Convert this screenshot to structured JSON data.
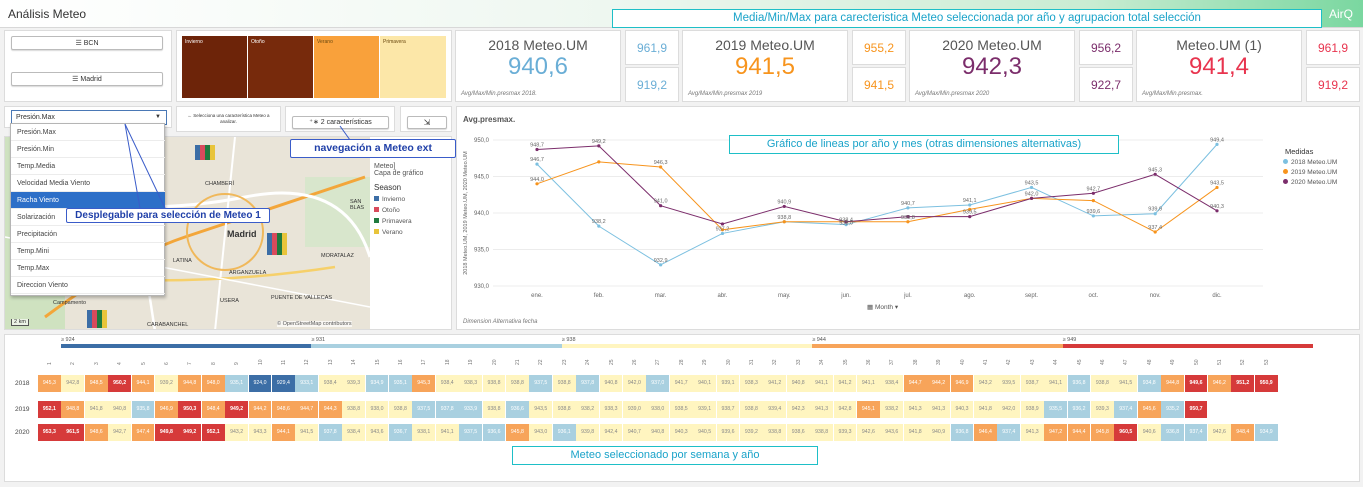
{
  "app": {
    "title": "Análisis Meteo",
    "brand": "AirQ"
  },
  "annotations": {
    "kpis": "Media/Min/Max  para carecteristica Meteo seleccionada por año y agrupacion total selección",
    "line": "Gráfico de lineas por año y mes (otras dimensiones alternativas)",
    "dropdown": "Desplegable para selección de Meteo 1",
    "nav": "navegación a Meteo ext",
    "heatmap": "Meteo seleccionado por semana y año"
  },
  "filters": {
    "bcn": "BCN",
    "madrid": "Madrid"
  },
  "seasons_tree": [
    {
      "label": "Invierno",
      "color": "#6d2409"
    },
    {
      "label": "Otoño",
      "color": "#772a0c"
    },
    {
      "label": "Verano",
      "color": "#f9a13b"
    },
    {
      "label": "Primavera",
      "color": "#fce7a8"
    }
  ],
  "controls": {
    "hint": "← Selecciona una característica Meteo a analizar.",
    "chars_button": "2 características",
    "export_icon": "export-icon"
  },
  "dropdown": {
    "selected": "Presión.Max",
    "items": [
      "Presión.Max",
      "Presión.Min",
      "Temp.Media",
      "Velocidad Media Viento",
      "Racha Viento",
      "Solarización",
      "Precipitación",
      "Temp.Mini",
      "Temp.Max",
      "Direccion Viento"
    ],
    "highlighted": "Racha Viento"
  },
  "map": {
    "labels": [
      "CHAMBERÍ",
      "SAN BLAS",
      "Madrid",
      "LATINA",
      "ARGANZUELA",
      "MORATALAZ",
      "USERA",
      "PUENTE DE VALLECAS",
      "Campamento",
      "CARABANCHEL"
    ],
    "legend_head": "Meteo]",
    "legend_sub": "Capa de gráfico",
    "legend_title": "Season",
    "legend": [
      {
        "label": "Invierno",
        "color": "#3c6ea6"
      },
      {
        "label": "Otoño",
        "color": "#d94a5c"
      },
      {
        "label": "Primavera",
        "color": "#1f7a3f"
      },
      {
        "label": "Verano",
        "color": "#e8c43a"
      }
    ],
    "scale": "2 km",
    "credit": "© OpenStreetMap contributors"
  },
  "kpis": [
    {
      "title": "2018 Meteo.UM",
      "value": "940,6",
      "color": "#6aaed6",
      "max": "961,9",
      "min": "919,2",
      "foot": "Avg/Max/Min.presmax 2018."
    },
    {
      "title": "2019 Meteo.UM",
      "value": "941,5",
      "color": "#f7941d",
      "max": "955,2",
      "min": "941,5",
      "foot": "Avg/Max/Min.presmax 2019"
    },
    {
      "title": "2020 Meteo.UM",
      "value": "942,3",
      "color": "#7b2d6b",
      "max": "956,2",
      "min": "922,7",
      "foot": "Avg/Max/Min.presmax 2020"
    },
    {
      "title": "Meteo.UM (1)",
      "value": "941,4",
      "color": "#e8344e",
      "max": "961,9",
      "min": "919,2",
      "foot": "Avg/Max/Min.presmax."
    }
  ],
  "line_panel": {
    "title": "Avg.presmax.",
    "footer": "Dimension Alternativa fecha",
    "month_label": "Month"
  },
  "chart_data": {
    "type": "line",
    "title": "Avg.presmax.",
    "ylabel": "2018 Meteo.UM, 2019 Meteo.UM, 2020 Meteo.UM",
    "xlabel": "Month",
    "ylim": [
      930,
      950
    ],
    "yticks": [
      "930,0",
      "935,0",
      "940,0",
      "945,0",
      "950,0"
    ],
    "categories": [
      "ene.",
      "feb.",
      "mar.",
      "abr.",
      "may.",
      "jun.",
      "jul.",
      "ago.",
      "sept.",
      "oct.",
      "nov.",
      "dic."
    ],
    "legend_title": "Medidas",
    "series": [
      {
        "name": "2018 Meteo.UM",
        "color": "#7cc0e0",
        "values": [
          946.7,
          938.2,
          932.9,
          937.2,
          938.8,
          938.4,
          940.7,
          941.1,
          943.5,
          939.6,
          939.9,
          949.4
        ]
      },
      {
        "name": "2019 Meteo.UM",
        "color": "#f7941d",
        "values": [
          944.0,
          947.0,
          946.3,
          937.7,
          938.8,
          938.8,
          938.8,
          940.5,
          942.0,
          941.7,
          937.4,
          943.5
        ]
      },
      {
        "name": "2020 Meteo.UM",
        "color": "#7b2d6b",
        "values": [
          948.7,
          949.2,
          941.0,
          938.5,
          940.9,
          938.8,
          939.5,
          939.5,
          942.0,
          942.7,
          945.3,
          940.3
        ]
      }
    ],
    "labels": [
      {
        "text": "948,7",
        "ci": 0,
        "v": 948.7
      },
      {
        "text": "946,7",
        "ci": 0,
        "v": 946.7
      },
      {
        "text": "944,0",
        "ci": 0,
        "v": 944.0
      },
      {
        "text": "949,2",
        "ci": 1,
        "v": 949.2
      },
      {
        "text": "938,2",
        "ci": 1,
        "v": 938.2
      },
      {
        "text": "946,3",
        "ci": 2,
        "v": 946.3
      },
      {
        "text": "941,0",
        "ci": 2,
        "v": 941.0
      },
      {
        "text": "932,9",
        "ci": 2,
        "v": 932.9
      },
      {
        "text": "937,2",
        "ci": 3,
        "v": 937.2
      },
      {
        "text": "940,9",
        "ci": 4,
        "v": 940.9
      },
      {
        "text": "938,8",
        "ci": 4,
        "v": 938.8
      },
      {
        "text": "938,4",
        "ci": 5,
        "v": 938.4
      },
      {
        "text": "938,0",
        "ci": 5,
        "v": 938.0
      },
      {
        "text": "940,7",
        "ci": 6,
        "v": 940.7
      },
      {
        "text": "938,8",
        "ci": 6,
        "v": 938.8
      },
      {
        "text": "941,1",
        "ci": 7,
        "v": 941.1
      },
      {
        "text": "939,5",
        "ci": 7,
        "v": 939.5
      },
      {
        "text": "943,5",
        "ci": 8,
        "v": 943.5
      },
      {
        "text": "942,0",
        "ci": 8,
        "v": 942.0
      },
      {
        "text": "942,7",
        "ci": 9,
        "v": 942.7
      },
      {
        "text": "939,6",
        "ci": 9,
        "v": 939.6
      },
      {
        "text": "945,3",
        "ci": 10,
        "v": 945.3
      },
      {
        "text": "939,9",
        "ci": 10,
        "v": 939.9
      },
      {
        "text": "937,4",
        "ci": 10,
        "v": 937.4
      },
      {
        "text": "949,4",
        "ci": 11,
        "v": 949.4
      },
      {
        "text": "943,5",
        "ci": 11,
        "v": 943.5
      },
      {
        "text": "940,3",
        "ci": 11,
        "v": 940.3
      }
    ]
  },
  "heatmap": {
    "scale": [
      {
        "label": "≥ 924",
        "color": "#3c6ea6"
      },
      {
        "label": "≥ 931",
        "color": "#a9d0e0"
      },
      {
        "label": "≥ 938",
        "color": "#fff5c0"
      },
      {
        "label": "≥ 944",
        "color": "#f7a45a"
      },
      {
        "label": "≥ 949",
        "color": "#d63a3a"
      }
    ],
    "weeks": [
      "1",
      "2",
      "3",
      "4",
      "5",
      "6",
      "7",
      "8",
      "9",
      "10",
      "11",
      "12",
      "13",
      "14",
      "15",
      "16",
      "17",
      "18",
      "19",
      "20",
      "21",
      "22",
      "23",
      "24",
      "25",
      "26",
      "27",
      "28",
      "29",
      "30",
      "31",
      "32",
      "33",
      "34",
      "35",
      "36",
      "37",
      "38",
      "39",
      "40",
      "41",
      "42",
      "43",
      "44",
      "45",
      "46",
      "47",
      "48",
      "49",
      "50",
      "51",
      "52",
      "53"
    ],
    "rows": [
      {
        "year": "2018",
        "values": [
          "945,3",
          "942,8",
          "948,5",
          "950,2",
          "944,1",
          "939,2",
          "944,8",
          "948,0",
          "935,1",
          "924,0",
          "929,4",
          "933,1",
          "938,4",
          "939,3",
          "934,9",
          "935,1",
          "945,3",
          "938,4",
          "938,3",
          "938,8",
          "938,8",
          "937,5",
          "938,8",
          "937,8",
          "940,8",
          "942,0",
          "937,0",
          "941,7",
          "940,1",
          "939,1",
          "938,3",
          "941,2",
          "940,8",
          "941,1",
          "941,2",
          "941,1",
          "938,4",
          "944,7",
          "944,2",
          "946,9",
          "943,2",
          "939,5",
          "938,7",
          "941,1",
          "936,8",
          "938,8",
          "941,5",
          "934,8",
          "944,8",
          "949,6",
          "946,2",
          "951,2",
          "950,9"
        ]
      },
      {
        "year": "2019",
        "values": [
          "952,1",
          "948,8",
          "941,8",
          "940,8",
          "935,8",
          "946,9",
          "950,3",
          "948,4",
          "949,2",
          "944,2",
          "948,6",
          "944,7",
          "944,3",
          "938,8",
          "938,0",
          "938,8",
          "937,5",
          "937,8",
          "933,9",
          "938,8",
          "936,6",
          "943,5",
          "938,8",
          "938,2",
          "938,3",
          "939,0",
          "938,0",
          "938,5",
          "939,1",
          "938,7",
          "938,8",
          "939,4",
          "942,3",
          "941,3",
          "942,8",
          "945,1",
          "938,2",
          "941,3",
          "941,3",
          "940,3",
          "941,8",
          "942,0",
          "938,9",
          "935,5",
          "936,2",
          "939,3",
          "937,4",
          "945,6",
          "935,2",
          "950,7"
        ]
      },
      {
        "year": "2020",
        "values": [
          "953,3",
          "961,5",
          "948,6",
          "942,7",
          "947,4",
          "949,8",
          "949,2",
          "952,1",
          "943,2",
          "943,3",
          "944,1",
          "941,5",
          "937,8",
          "938,4",
          "943,6",
          "936,7",
          "938,1",
          "941,1",
          "937,5",
          "936,6",
          "945,8",
          "943,0",
          "936,1",
          "939,8",
          "942,4",
          "940,7",
          "940,8",
          "940,3",
          "940,5",
          "939,6",
          "939,2",
          "938,8",
          "938,6",
          "938,8",
          "939,3",
          "942,6",
          "943,6",
          "941,8",
          "940,9",
          "936,8",
          "946,4",
          "937,4",
          "941,3",
          "947,2",
          "944,4",
          "945,8",
          "960,5",
          "940,6",
          "936,8",
          "937,4",
          "942,6",
          "948,4",
          "934,9"
        ]
      }
    ]
  }
}
